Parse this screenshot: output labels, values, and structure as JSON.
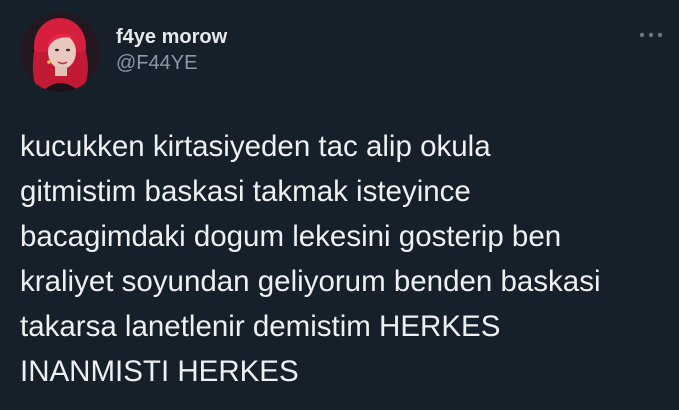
{
  "author": {
    "display_name": "f4ye morow",
    "handle": "@F44YE",
    "avatar_icon": "profile-photo"
  },
  "menu": {
    "icon": "more-options-icon"
  },
  "tweet": {
    "lines": [
      "kucukken kirtasiyeden tac alip okula",
      "gitmistim baskasi takmak isteyince",
      "bacagimdaki dogum lekesini gosterip ben",
      "kraliyet soyundan geliyorum benden baskasi",
      "takarsa lanetlenir demistim HERKES",
      "INANMISTI HERKES"
    ]
  },
  "colors": {
    "background": "#15202b",
    "text_primary": "#e7e9ea",
    "text_secondary": "#8b98a5",
    "avatar_hair": "#e0233f"
  }
}
